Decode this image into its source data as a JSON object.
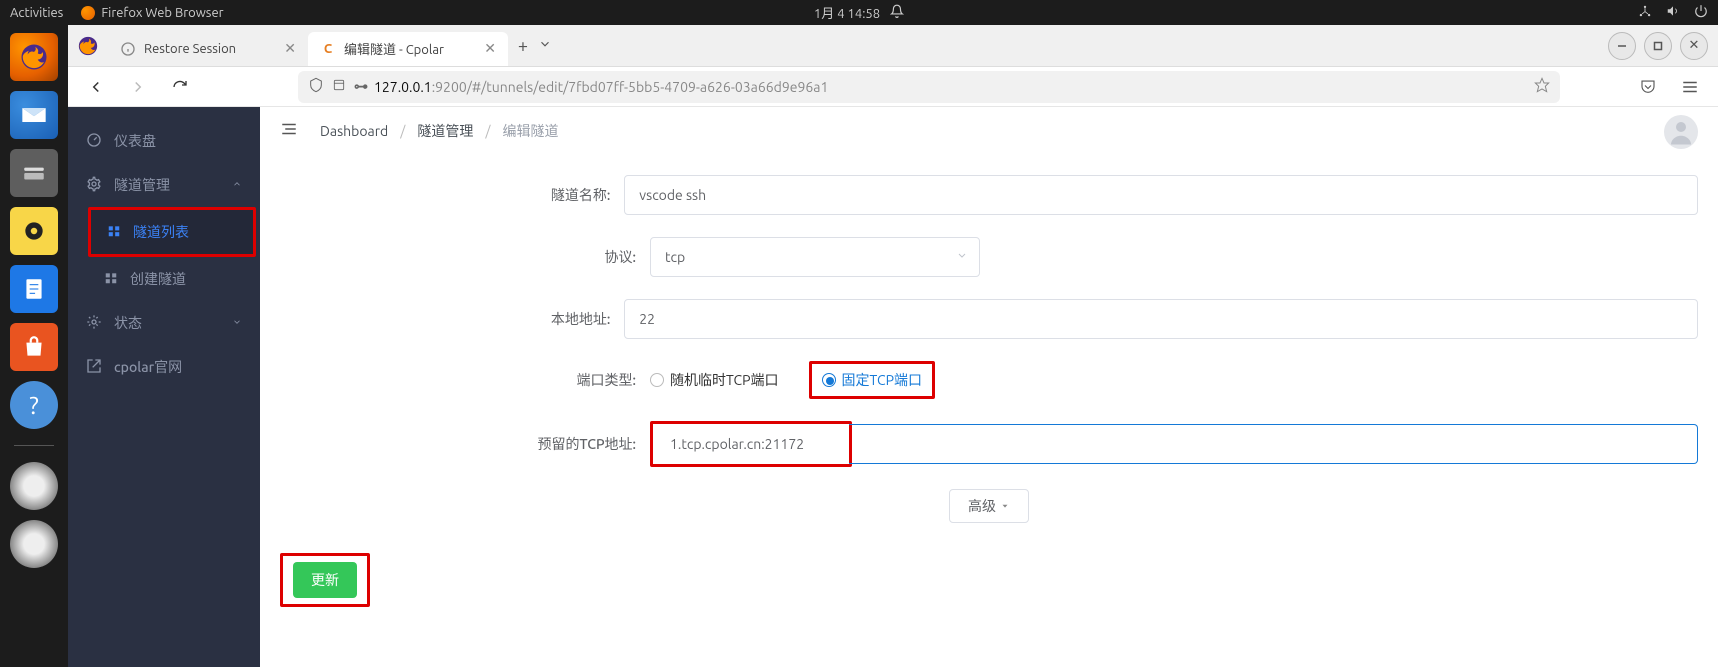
{
  "gnome": {
    "activities": "Activities",
    "app": "Firefox Web Browser",
    "clock": "1月 4  14:58"
  },
  "tabs": {
    "t1": {
      "label": "Restore Session"
    },
    "t2": {
      "label": "编辑隧道 - Cpolar",
      "favicon_letter": "C"
    }
  },
  "url": {
    "host": "127.0.0.1",
    "path": ":9200/#/tunnels/edit/7fbd07ff-5bb5-4709-a626-03a66d9e96a1"
  },
  "sidebar": {
    "dashboard": "仪表盘",
    "tunnels": "隧道管理",
    "tunnel_list": "隧道列表",
    "tunnel_create": "创建隧道",
    "status": "状态",
    "site": "cpolar官网"
  },
  "breadcrumb": {
    "b1": "Dashboard",
    "b2": "隧道管理",
    "b3": "编辑隧道"
  },
  "form": {
    "name_label": "隧道名称:",
    "name_value": "vscode ssh",
    "proto_label": "协议:",
    "proto_value": "tcp",
    "localaddr_label": "本地地址:",
    "localaddr_value": "22",
    "porttype_label": "端口类型:",
    "port_random": "随机临时TCP端口",
    "port_fixed": "固定TCP端口",
    "reserved_label": "预留的TCP地址:",
    "reserved_value": "1.tcp.cpolar.cn:21172",
    "advanced": "高级",
    "submit": "更新"
  }
}
